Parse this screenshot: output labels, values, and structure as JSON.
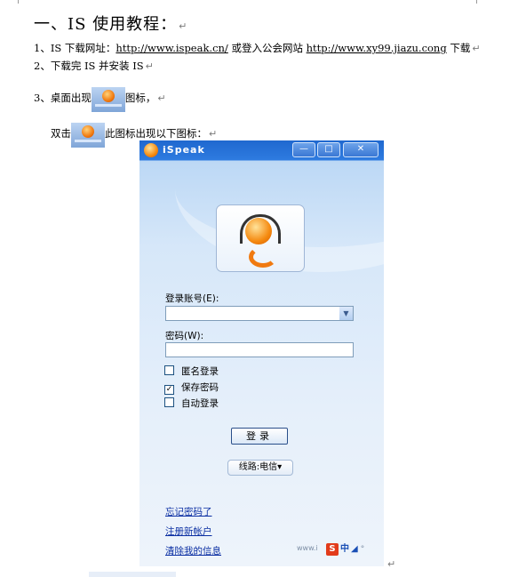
{
  "doc": {
    "title": "一、IS 使用教程：",
    "para_mark": "↵",
    "line1": {
      "prefix": "1、IS 下载网址：",
      "link1": "http://www.ispeak.cn/",
      "middle": "  或登入公会网站 ",
      "link2": "http://www.xy99.jiazu.cong",
      "suffix": " 下载"
    },
    "line2": "2、下载完 IS 并安装 IS",
    "line3": {
      "before": "3、桌面出现",
      "after": "图标，"
    },
    "line4": {
      "before": "双击",
      "after": "此图标出现以下图标："
    }
  },
  "window": {
    "app_title": "iSpeak",
    "min_label": "—",
    "max_label": "□",
    "close_label": "✕",
    "account_label": "登录账号(E):",
    "combo_arrow": "▼",
    "password_label": "密码(W):",
    "options": [
      {
        "label": "匿名登录",
        "checked": false,
        "mark": ""
      },
      {
        "label": "保存密码",
        "checked": true,
        "mark": "✓"
      },
      {
        "label": "自动登录",
        "checked": false,
        "mark": ""
      }
    ],
    "login_button": "登录",
    "route_button": "线路:电信▾",
    "links": [
      "忘记密码了",
      "注册新帐户",
      "清除我的信息"
    ],
    "status_text": "www.i",
    "ime": {
      "s": "S",
      "zh": "中",
      "moon": "◢",
      "dot": "°"
    }
  },
  "colors": {
    "titlebar": "#1f68cf",
    "link": "#0b2fa3",
    "logo_orange": "#f58a10"
  },
  "icons": [
    "ispeak-logo-icon",
    "headset-icon",
    "checkbox-icon",
    "dropdown-arrow-icon"
  ]
}
